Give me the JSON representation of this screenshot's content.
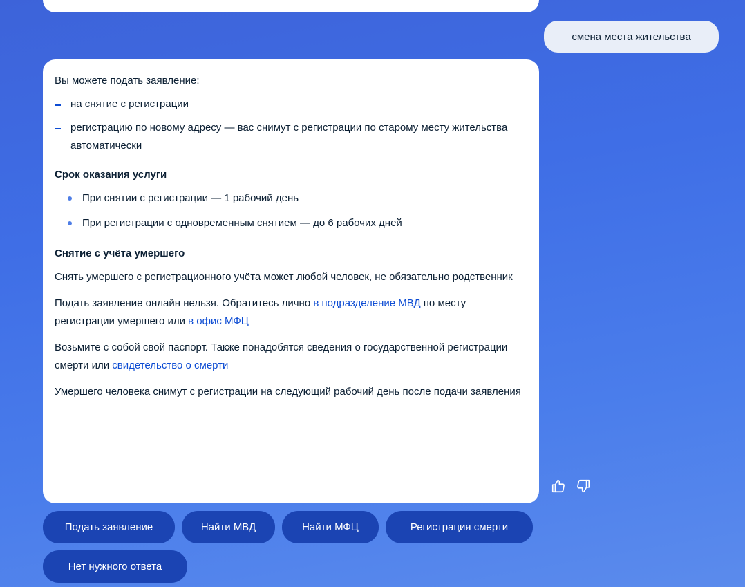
{
  "user_message": "смена места жительства",
  "bot": {
    "intro": "Вы можете подать заявление:",
    "options": [
      "на снятие с регистрации",
      "регистрацию по новому адресу — вас снимут с регистрации по старому месту жительства автоматически"
    ],
    "term_heading": "Срок оказания услуги",
    "terms": [
      "При снятии с регистрации — 1 рабочий день",
      "При регистрации с одновременным снятием — до 6 рабочих дней"
    ],
    "deceased_heading": "Снятие с учёта умершего",
    "p1": "Снять умершего с регистрационного учёта может любой человек, не обязательно родственник",
    "p2_a": "Подать заявление онлайн нельзя. Обратитесь лично ",
    "p2_link1": "в подразделение МВД",
    "p2_b": " по месту регистрации умершего или ",
    "p2_link2": "в офис МФЦ",
    "p3_a": "Возьмите с собой свой паспорт. Также понадобятся сведения о государственной регистрации смерти или ",
    "p3_link": "свидетельство о смерти",
    "p4": "Умершего человека снимут с регистрации на следующий рабочий день после подачи заявления"
  },
  "feedback": {
    "like_icon": "thumbs-up-icon",
    "dislike_icon": "thumbs-down-icon"
  },
  "chips": [
    "Подать заявление",
    "Найти МВД",
    "Найти МФЦ",
    "Регистрация смерти",
    "Нет нужного ответа"
  ],
  "colors": {
    "accent": "#0d4cd3",
    "chip_bg": "#1b44b3",
    "bubble_bg": "#ffffff",
    "user_bubble_bg": "#e9eef8"
  }
}
